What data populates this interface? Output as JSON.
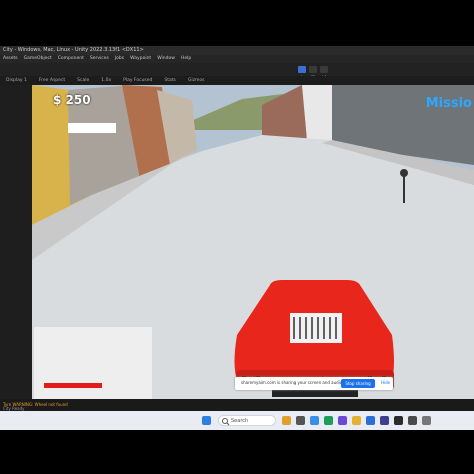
{
  "window": {
    "title": "City - Windows, Mac, Linux - Unity 2022.3.13f1 <DX11>"
  },
  "menu": [
    "Assets",
    "GameObject",
    "Component",
    "Services",
    "Jobs",
    "Waypoint",
    "Window",
    "Help"
  ],
  "tabs": [
    "Display 1",
    "Free Aspect",
    "Scale",
    "1.0x",
    "Play Focused",
    "Stats",
    "Gizmos"
  ],
  "hud": {
    "money": "$ 250",
    "mission": "Missio"
  },
  "share_banner": {
    "text": "sharemyaim.com is sharing your screen and audio.",
    "stop_label": "Stop sharing",
    "hide_label": "Hide"
  },
  "console": {
    "warning": "Tyre WARNING: Wheel not found",
    "status": "City Ready"
  },
  "taskbar": {
    "search_placeholder": "Search"
  },
  "colors": {
    "car": "#e8261c",
    "sky": "#a8b8c8",
    "mission_text": "#2ea8ff",
    "health": "#e21b1b",
    "accent": "#1a73e8"
  }
}
